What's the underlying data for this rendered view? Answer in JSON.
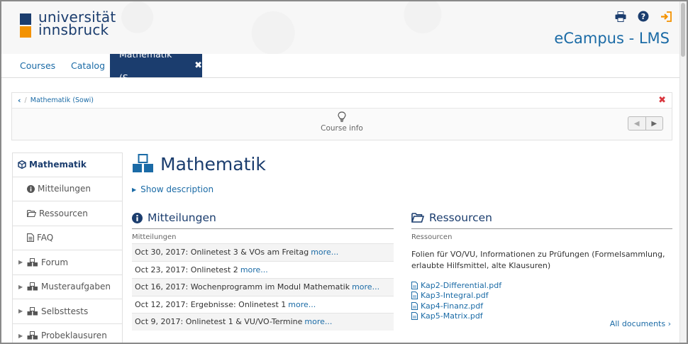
{
  "header": {
    "logo_text_line1": "universität",
    "logo_text_line2": "innsbruck",
    "app_title": "eCampus - LMS",
    "colors": {
      "brand_dark": "#1b3d6e",
      "brand_orange": "#f39200",
      "link": "#1b6ba6",
      "danger": "#d9363e"
    },
    "icons": [
      "print-icon",
      "help-icon",
      "logout-icon"
    ]
  },
  "nav": {
    "courses": "Courses",
    "catalog": "Catalog",
    "active_tab": "Mathematik (S...",
    "close_icon": "close-icon"
  },
  "coursebar": {
    "breadcrumb_back": "<",
    "breadcrumb_item": "Mathematik (Sowi)",
    "course_info_label": "Course info"
  },
  "sidebar": {
    "root": "Mathematik",
    "items": [
      {
        "label": "Mitteilungen",
        "icon": "info-icon"
      },
      {
        "label": "Ressourcen",
        "icon": "folder-icon"
      },
      {
        "label": "FAQ",
        "icon": "document-icon"
      },
      {
        "label": "Forum",
        "icon": "cubes-icon"
      },
      {
        "label": "Musteraufgaben",
        "icon": "cubes-icon"
      },
      {
        "label": "Selbsttests",
        "icon": "cubes-icon"
      },
      {
        "label": "Probeklausuren",
        "icon": "cubes-icon"
      }
    ]
  },
  "main": {
    "title": "Mathematik",
    "show_description": "Show description",
    "news": {
      "heading": "Mitteilungen",
      "subheading": "Mitteilungen",
      "rows": [
        {
          "text": "Oct 30, 2017: Onlinetest 3 & VOs am Freitag",
          "more": "more..."
        },
        {
          "text": "Oct 23, 2017: Onlinetest 2",
          "more": "more..."
        },
        {
          "text": "Oct 16, 2017: Wochenprogramm im Modul Mathematik",
          "more": "more..."
        },
        {
          "text": "Oct 12, 2017: Ergebnisse: Onlinetest 1",
          "more": "more..."
        },
        {
          "text": "Oct 9, 2017: Onlinetest 1 & VU/VO-Termine",
          "more": "more..."
        }
      ]
    },
    "resources": {
      "heading": "Ressourcen",
      "subheading": "Ressourcen",
      "description": "Folien für VO/VU, Informationen zu Prüfungen (Formelsammlung, erlaubte Hilfsmittel, alte Klausuren)",
      "files": [
        "Kap2-Differential.pdf",
        "Kap3-Integral.pdf",
        "Kap4-Finanz.pdf",
        "Kap5-Matrix.pdf"
      ],
      "all_documents": "All documents"
    }
  }
}
